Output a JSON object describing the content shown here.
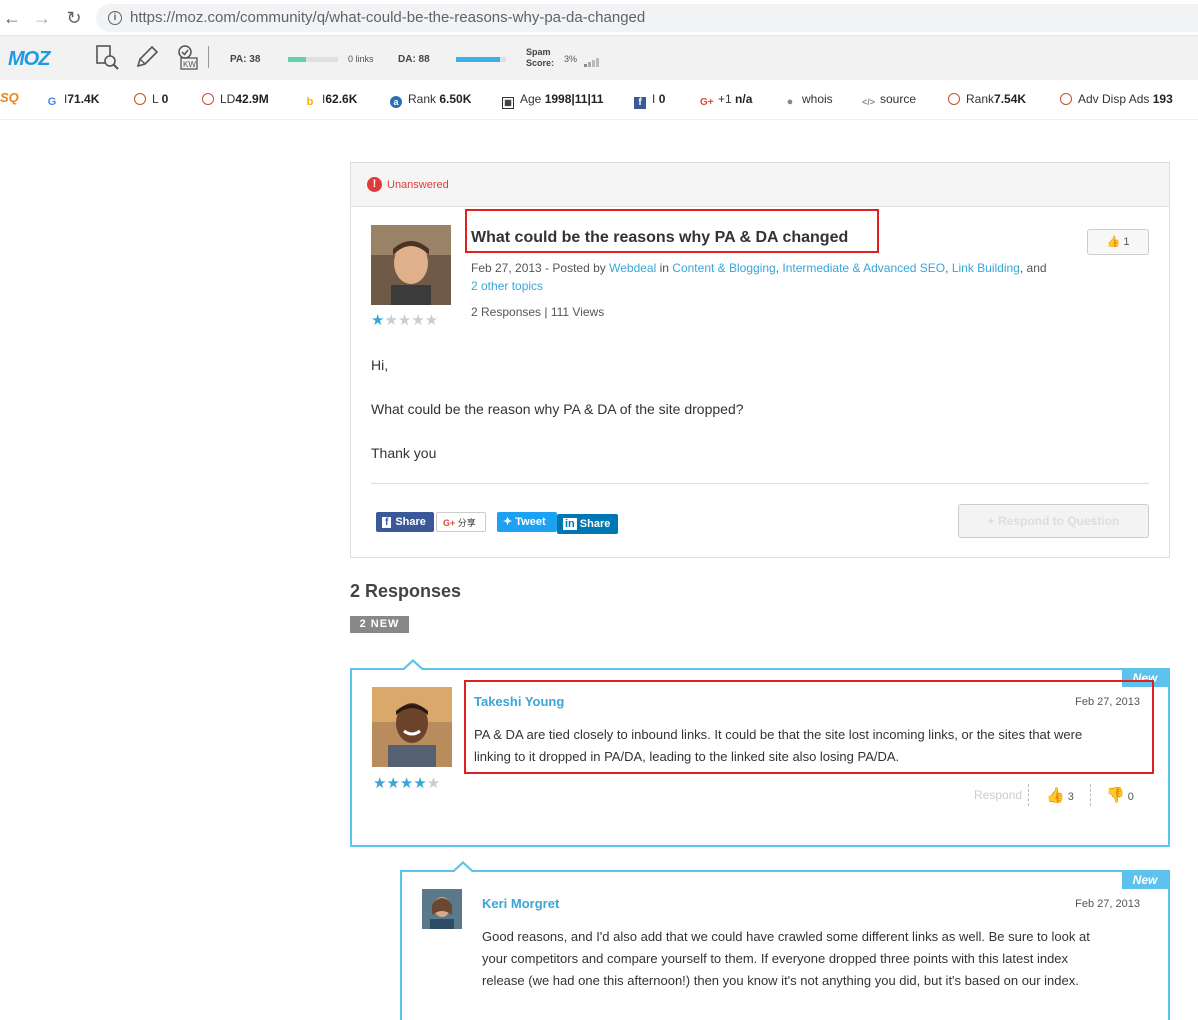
{
  "browser": {
    "url": "https://moz.com/community/q/what-could-be-the-reasons-why-pa-da-changed"
  },
  "mozbar": {
    "logo": "MOZ",
    "pa_label": "PA: 38",
    "links_label": "0 links",
    "da_label": "DA: 88",
    "spam_label_1": "Spam",
    "spam_label_2": "Score:",
    "spam_value": "3%"
  },
  "seobar": {
    "google_prefix": "I",
    "google_value": "71.4K",
    "l_prefix": "L",
    "l_value": "0",
    "ld_prefix": "LD",
    "ld_value": "42.9M",
    "bing_prefix": "I",
    "bing_value": "62.6K",
    "alexa_prefix": "Rank",
    "alexa_value": "6.50K",
    "age_prefix": "Age",
    "age_value": "1998|11|11",
    "fb_prefix": "I",
    "fb_value": "0",
    "gplus_prefix": "+1",
    "gplus_value": "n/a",
    "whois": "whois",
    "source": "source",
    "rank2_prefix": "Rank",
    "rank2_value": "7.54K",
    "ads_prefix": "Adv Disp Ads",
    "ads_value": "193"
  },
  "question": {
    "status": "Unanswered",
    "title": "What could be the reasons why PA & DA changed",
    "meta_pre": "Feb 27, 2013 - Posted by",
    "author": "Webdeal",
    "meta_in": "in",
    "topic1": "Content & Blogging",
    "topic2": "Intermediate & Advanced SEO",
    "topic3": "Link Building",
    "meta_and": ", and",
    "other_topics": "2 other topics",
    "responses_views": "2 Responses | 111 Views",
    "likes": "1",
    "rating": 1,
    "body": [
      "Hi,",
      "What could be the reason why PA & DA of the site dropped?",
      "Thank you"
    ],
    "share_fb": "Share",
    "share_gplus": "分享",
    "share_tweet": "Tweet",
    "share_in": "Share",
    "respond_button": "+ Respond to Question"
  },
  "responses": {
    "title": "2 Responses",
    "new_badge": "2 NEW",
    "items": [
      {
        "tag": "New",
        "name": "Takeshi Young",
        "date": "Feb 27, 2013",
        "text_1": "PA & DA are tied closely to inbound links. It could be that the site lost incoming links, or the sites that were",
        "text_2": "linking to it dropped in PA/DA, leading to the linked site also losing PA/DA.",
        "rating": 4,
        "respond": "Respond",
        "thumbs_up": "3",
        "thumbs_down": "0"
      },
      {
        "tag": "New",
        "name": "Keri Morgret",
        "date": "Feb 27, 2013",
        "text_1": "Good reasons, and I'd also add that we could have crawled some different links as well. Be sure to look at",
        "text_2": "your competitors and compare yourself to them. If everyone dropped three points with this latest index",
        "text_3": "release (we had one this afternoon!) then you know it's not anything you did, but it's based on our index."
      }
    ]
  },
  "colors": {
    "accent": "#3aa5d8",
    "alert": "#e03b3b",
    "new_tag": "#5ec3ec",
    "highlight": "#e02020"
  }
}
